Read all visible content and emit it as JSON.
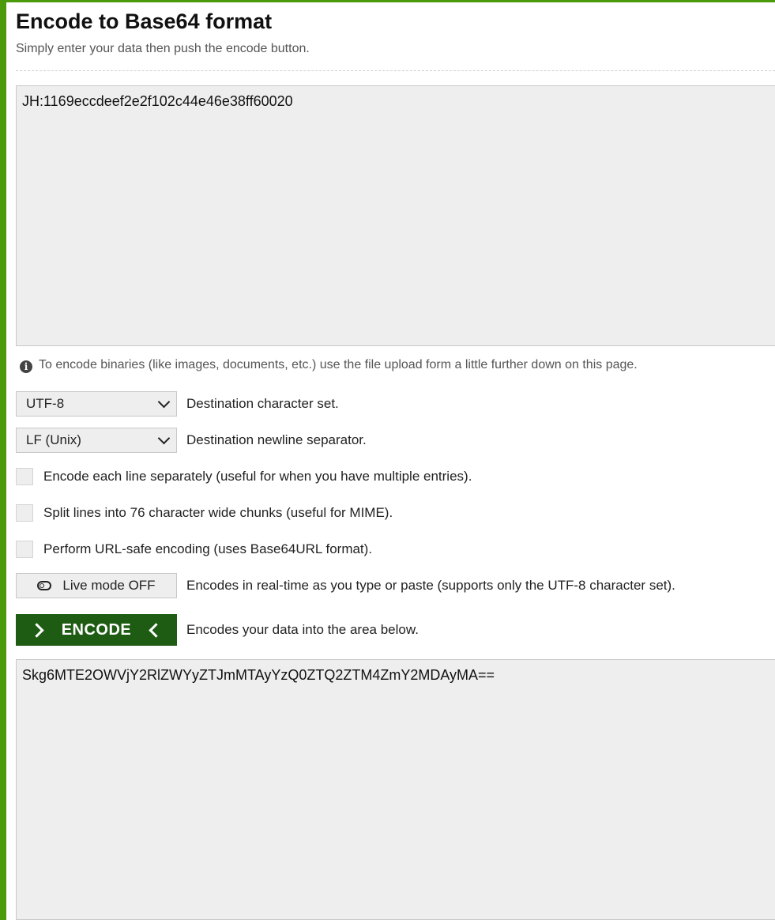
{
  "header": {
    "title": "Encode to Base64 format",
    "subtitle": "Simply enter your data then push the encode button."
  },
  "input": {
    "value": "JH:1169eccdeef2e2f102c44e46e38ff60020"
  },
  "info": {
    "text": "To encode binaries (like images, documents, etc.) use the file upload form a little further down on this page."
  },
  "charset": {
    "selected": "UTF-8",
    "label": "Destination character set."
  },
  "newline": {
    "selected": "LF (Unix)",
    "label": "Destination newline separator."
  },
  "options": {
    "each_line": "Encode each line separately (useful for when you have multiple entries).",
    "split_lines": "Split lines into 76 character wide chunks (useful for MIME).",
    "url_safe": "Perform URL-safe encoding (uses Base64URL format)."
  },
  "live_mode": {
    "button_label": "Live mode OFF",
    "description": "Encodes in real-time as you type or paste (supports only the UTF-8 character set)."
  },
  "encode": {
    "button_label": "ENCODE",
    "description": "Encodes your data into the area below."
  },
  "output": {
    "value": "Skg6MTE2OWVjY2RlZWYyZTJmMTAyYzQ0ZTQ2ZTM4ZmY2MDAyMA=="
  },
  "colors": {
    "accent": "#4a9a0c",
    "button": "#1d5c12",
    "field_bg": "#eeeeee"
  },
  "icons": [
    "info-icon",
    "chevron-down-icon",
    "toggle-icon",
    "chevron-right-icon",
    "chevron-left-icon"
  ]
}
